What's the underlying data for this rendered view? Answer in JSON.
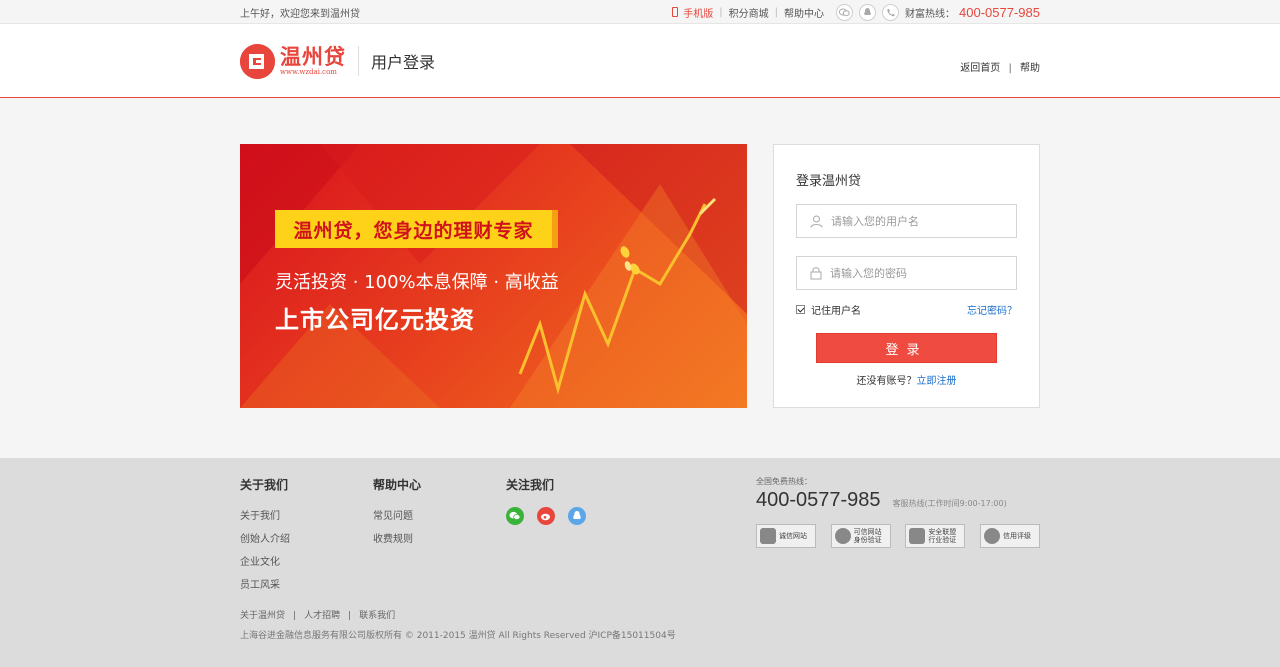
{
  "topbar": {
    "greeting": "上午好，欢迎您来到温州贷",
    "mobile_label": "手机版",
    "points_mall": "积分商城",
    "help_center": "帮助中心",
    "hotline_label": "财富热线：",
    "hotline_number": "400-0577-985"
  },
  "header": {
    "logo_cn": "温州贷",
    "logo_url": "www.wzdai.com",
    "page_title": "用户登录",
    "nav_home": "返回首页",
    "nav_sep": "|",
    "nav_help": "帮助"
  },
  "banner": {
    "slogan": "温州贷，您身边的理财专家",
    "subline": "灵活投资 · 100%本息保障 · 高收益",
    "headline": "上市公司亿元投资"
  },
  "login": {
    "title": "登录温州贷",
    "username_placeholder": "请输入您的用户名",
    "password_placeholder": "请输入您的密码",
    "remember_label": "记住用户名",
    "forgot_label": "忘记密码？",
    "submit_label": "登录",
    "no_account_text": "还没有账号？",
    "register_link": "立即注册"
  },
  "footer": {
    "col_about": {
      "title": "关于我们",
      "links": [
        "关于我们",
        "创始人介绍",
        "企业文化",
        "员工风采"
      ]
    },
    "col_help": {
      "title": "帮助中心",
      "links": [
        "常见问题",
        "收费规则"
      ]
    },
    "col_follow": {
      "title": "关注我们",
      "icons": [
        "wechat-icon",
        "weibo-icon",
        "qq-icon"
      ]
    },
    "contact": {
      "label": "全国免费热线：",
      "number": "400-0577-985",
      "hours": "客服热线(工作时间9:00-17:00)"
    },
    "badges": [
      {
        "line1": "诚信网站",
        "line2": ""
      },
      {
        "line1": "可信网站",
        "line2": "身份验证"
      },
      {
        "line1": "安全联盟",
        "line2": "行业验证"
      },
      {
        "line1": "信用评级",
        "line2": ""
      }
    ],
    "bottom_links": [
      "关于温州贷",
      "人才招聘",
      "联系我们"
    ],
    "copyright": "上海谷进金融信息服务有限公司版权所有 © 2011-2015 温州贷 All Rights Reserved 沪ICP备15011504号"
  },
  "colors": {
    "brand_red": "#e8463c",
    "link_blue": "#1a6dcc",
    "banner_yellow": "#ffd21a"
  }
}
